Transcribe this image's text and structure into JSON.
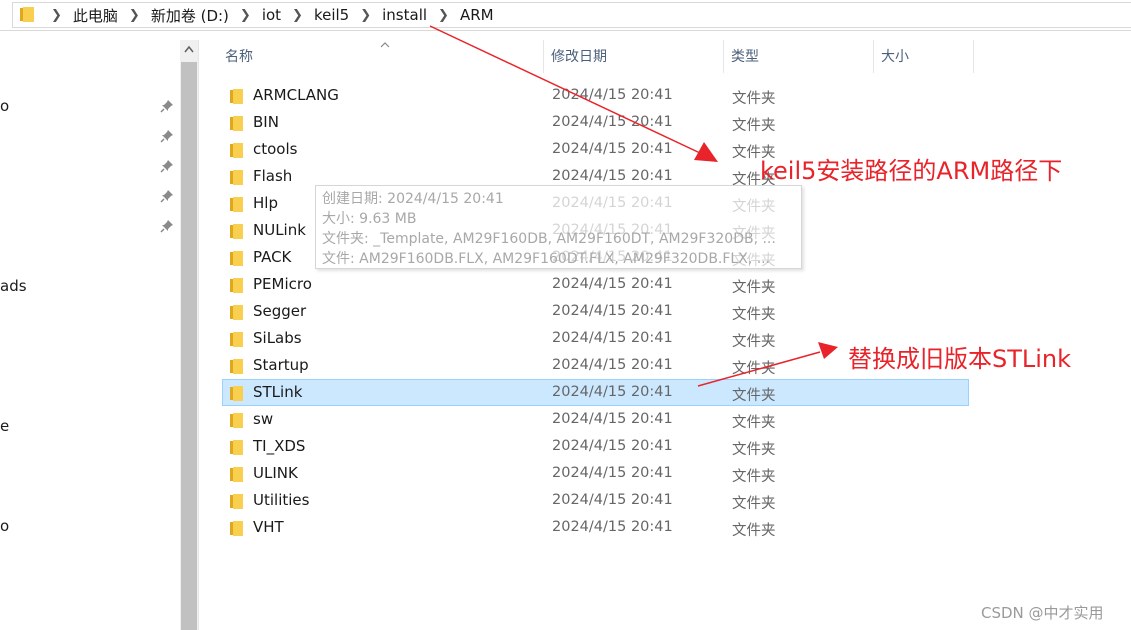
{
  "address_bar": {
    "crumbs": [
      "此电脑",
      "新加卷 (D:)",
      "iot",
      "keil5",
      "install",
      "ARM"
    ]
  },
  "nav_pane": {
    "fragments": [
      "o",
      "ads",
      "e",
      "o"
    ]
  },
  "columns": {
    "name": "名称",
    "date": "修改日期",
    "type": "类型",
    "size": "大小"
  },
  "files": [
    {
      "name": "ARMCLANG",
      "date": "2024/4/15 20:41",
      "type": "文件夹"
    },
    {
      "name": "BIN",
      "date": "2024/4/15 20:41",
      "type": "文件夹"
    },
    {
      "name": "ctools",
      "date": "2024/4/15 20:41",
      "type": "文件夹"
    },
    {
      "name": "Flash",
      "date": "2024/4/15 20:41",
      "type": "文件夹"
    },
    {
      "name": "Hlp",
      "date": "2024/4/15 20:41",
      "type": "文件夹"
    },
    {
      "name": "NULink",
      "date": "2024/4/15 20:41",
      "type": "文件夹"
    },
    {
      "name": "PACK",
      "date": "2024/4/15 20:41",
      "type": "文件夹"
    },
    {
      "name": "PEMicro",
      "date": "2024/4/15 20:41",
      "type": "文件夹"
    },
    {
      "name": "Segger",
      "date": "2024/4/15 20:41",
      "type": "文件夹"
    },
    {
      "name": "SiLabs",
      "date": "2024/4/15 20:41",
      "type": "文件夹"
    },
    {
      "name": "Startup",
      "date": "2024/4/15 20:41",
      "type": "文件夹"
    },
    {
      "name": "STLink",
      "date": "2024/4/15 20:41",
      "type": "文件夹",
      "selected": true
    },
    {
      "name": "sw",
      "date": "2024/4/15 20:41",
      "type": "文件夹"
    },
    {
      "name": "TI_XDS",
      "date": "2024/4/15 20:41",
      "type": "文件夹"
    },
    {
      "name": "ULINK",
      "date": "2024/4/15 20:41",
      "type": "文件夹"
    },
    {
      "name": "Utilities",
      "date": "2024/4/15 20:41",
      "type": "文件夹"
    },
    {
      "name": "VHT",
      "date": "2024/4/15 20:41",
      "type": "文件夹"
    }
  ],
  "tooltip": {
    "created": "创建日期: 2024/4/15 20:41",
    "size": "大小: 9.63 MB",
    "folders": "文件夹: _Template, AM29F160DB, AM29F160DT, AM29F320DB, ...",
    "files": "文件: AM29F160DB.FLX, AM29F160DT.FLX, AM29F320DB.FLX, ..."
  },
  "annotations": {
    "path_note": "keil5安装路径的ARM路径下",
    "replace_note": "替换成旧版本STLink"
  },
  "watermark": "CSDN @中才实用",
  "colors": {
    "selection_bg": "#cce8ff",
    "selection_border": "#99d1ff",
    "annotation_red": "#e8232a",
    "folder_yellow": "#f8cf4f"
  }
}
